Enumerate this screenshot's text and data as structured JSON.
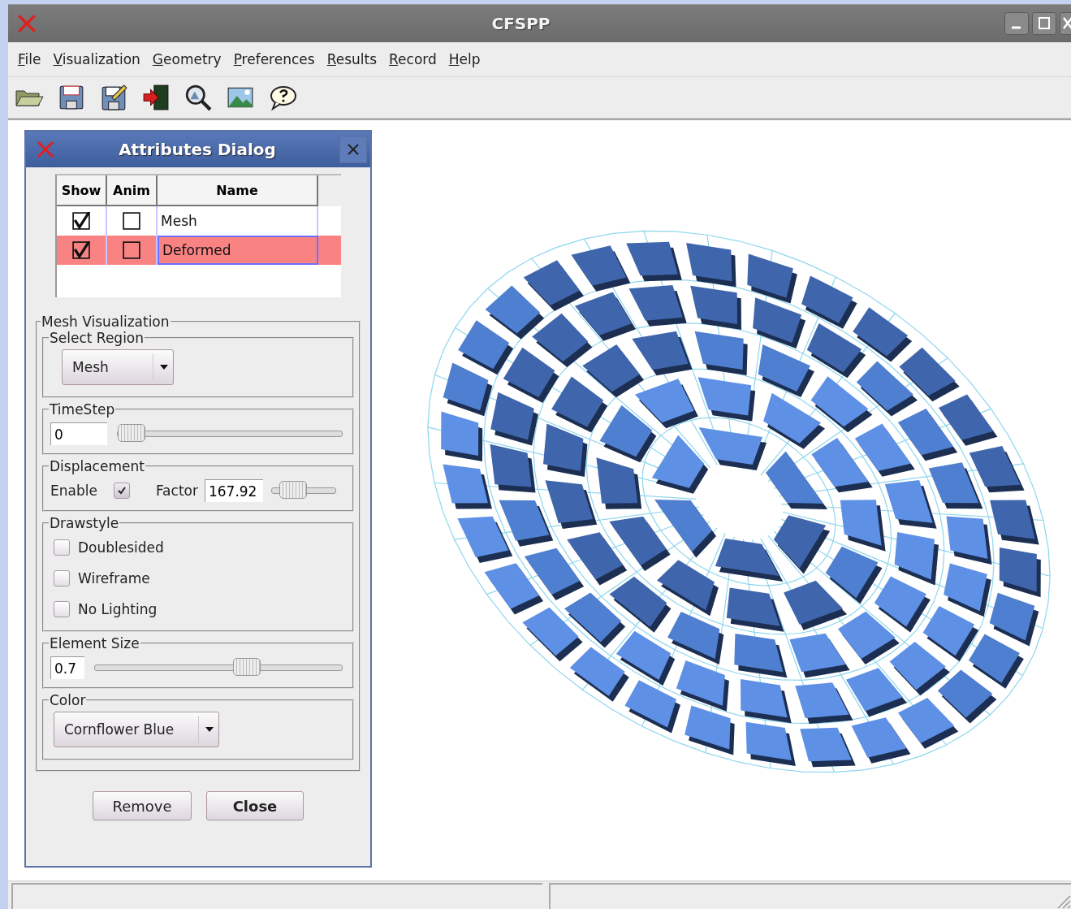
{
  "window": {
    "title": "CFSPP"
  },
  "menu": [
    "File",
    "Visualization",
    "Geometry",
    "Preferences",
    "Results",
    "Record",
    "Help"
  ],
  "dialog": {
    "title": "Attributes Dialog",
    "table": {
      "columns": [
        "Show",
        "Anim",
        "Name"
      ],
      "rows": [
        {
          "show": true,
          "anim": false,
          "name": "Mesh",
          "selected": false
        },
        {
          "show": true,
          "anim": false,
          "name": "Deformed",
          "selected": true
        }
      ]
    },
    "section_title": "Mesh Visualization",
    "select_region": {
      "title": "Select Region",
      "value": "Mesh"
    },
    "timestep": {
      "title": "TimeStep",
      "value": "0",
      "level": 0.0
    },
    "displacement": {
      "title": "Displacement",
      "enable_label": "Enable",
      "enabled": true,
      "factor_label": "Factor",
      "factor": "167.92",
      "level": 0.2
    },
    "drawstyle": {
      "title": "Drawstyle",
      "options": [
        {
          "label": "Doublesided",
          "checked": false
        },
        {
          "label": "Wireframe",
          "checked": false
        },
        {
          "label": "No Lighting",
          "checked": false
        }
      ]
    },
    "element_size": {
      "title": "Element Size",
      "value": "0.7",
      "level": 0.63
    },
    "color": {
      "title": "Color",
      "value": "Cornflower Blue"
    },
    "buttons": [
      {
        "label": "Remove",
        "default": false
      },
      {
        "label": "Close",
        "default": true
      }
    ]
  }
}
